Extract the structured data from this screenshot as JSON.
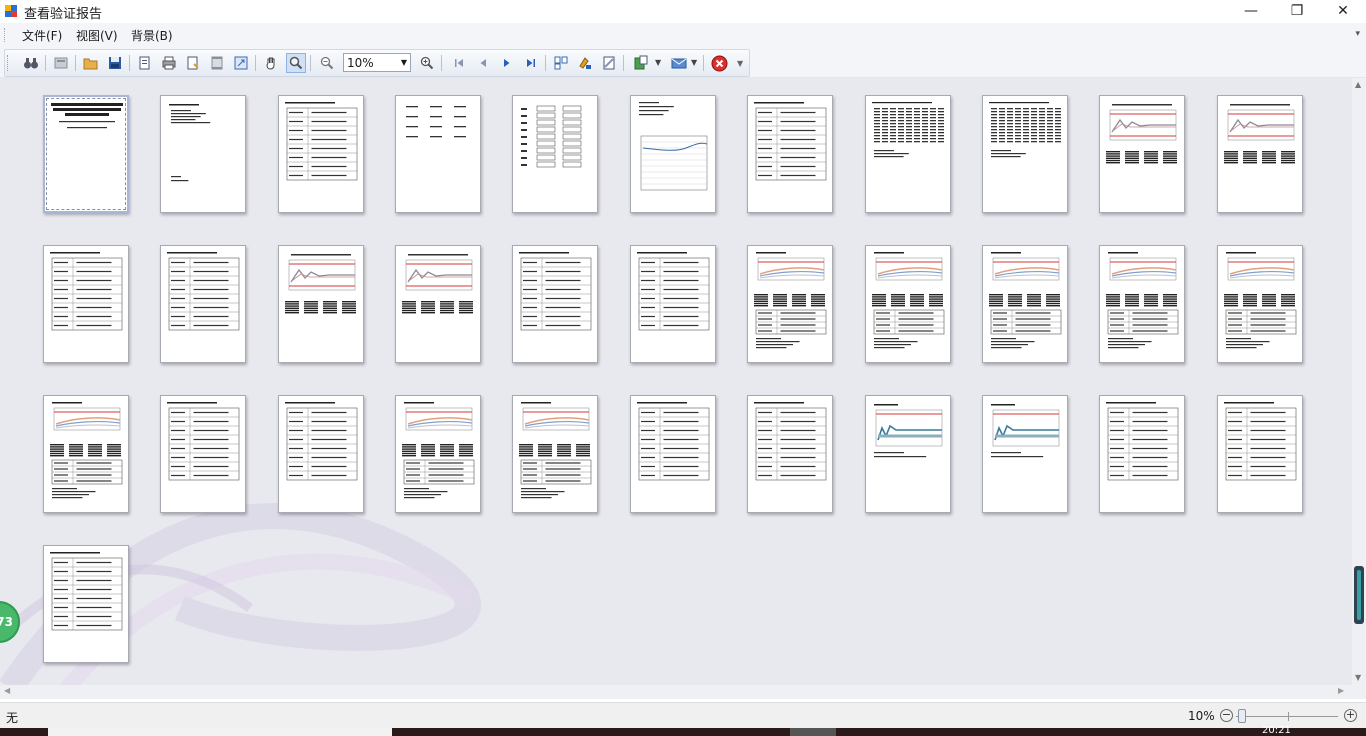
{
  "window": {
    "title": "查看验证报告",
    "controls": {
      "minimize": "—",
      "maximize": "❐",
      "close": "✕"
    }
  },
  "menubar": {
    "items": [
      {
        "label": "文件(F)"
      },
      {
        "label": "视图(V)"
      },
      {
        "label": "背景(B)"
      }
    ]
  },
  "toolbar": {
    "zoom_value": "10%",
    "buttons": [
      "find-icon",
      "thumbnails-icon",
      "open-icon",
      "save-icon",
      "page-setup-icon",
      "print-icon",
      "quick-print-icon",
      "header-footer-icon",
      "scale-icon",
      "hand-tool-icon",
      "magnifier-icon",
      "zoom-out-icon",
      "zoom-in-icon",
      "first-page-icon",
      "previous-page-icon",
      "next-page-icon",
      "last-page-icon",
      "multiple-pages-icon",
      "color-icon",
      "watermark-icon",
      "export-icon",
      "send-email-icon",
      "close-preview-icon"
    ]
  },
  "document": {
    "page_count": 34,
    "selected_page": 1,
    "pages": [
      {
        "kind": "cover"
      },
      {
        "kind": "toc"
      },
      {
        "kind": "table"
      },
      {
        "kind": "sparse"
      },
      {
        "kind": "grid"
      },
      {
        "kind": "lineplot"
      },
      {
        "kind": "table"
      },
      {
        "kind": "dense"
      },
      {
        "kind": "dense"
      },
      {
        "kind": "chart"
      },
      {
        "kind": "chart"
      },
      {
        "kind": "table"
      },
      {
        "kind": "table"
      },
      {
        "kind": "chart"
      },
      {
        "kind": "chart"
      },
      {
        "kind": "table"
      },
      {
        "kind": "table"
      },
      {
        "kind": "bandchart"
      },
      {
        "kind": "bandchart"
      },
      {
        "kind": "bandchart"
      },
      {
        "kind": "bandchart"
      },
      {
        "kind": "bandchart"
      },
      {
        "kind": "bandchart"
      },
      {
        "kind": "table"
      },
      {
        "kind": "table"
      },
      {
        "kind": "bandchart"
      },
      {
        "kind": "bandchart"
      },
      {
        "kind": "table"
      },
      {
        "kind": "table"
      },
      {
        "kind": "tealchart"
      },
      {
        "kind": "tealchart"
      },
      {
        "kind": "table"
      },
      {
        "kind": "table"
      },
      {
        "kind": "table"
      }
    ]
  },
  "floating_badge": {
    "label": "73"
  },
  "statusbar": {
    "left_text": "无",
    "zoom_label": "10%",
    "zoom_level_percent": 10,
    "minus": "−",
    "plus": "+"
  },
  "taskbar": {
    "clock": "20:21"
  },
  "colors": {
    "workspace": "#e8e9ef",
    "redline": "#d43a3a",
    "teal": "#4a8aa6"
  }
}
